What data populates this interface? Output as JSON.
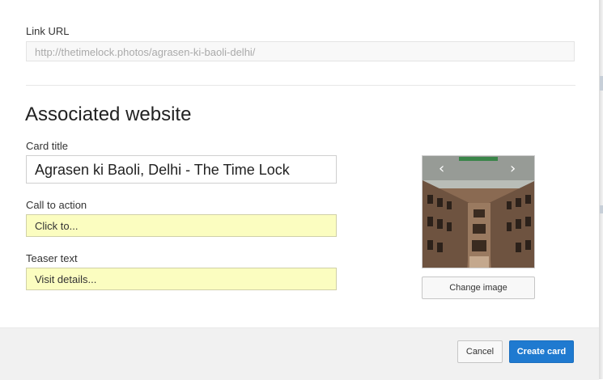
{
  "link_url": {
    "label": "Link URL",
    "value": "http://thetimelock.photos/agrasen-ki-baoli-delhi/"
  },
  "associated_website": {
    "heading": "Associated website",
    "card_title": {
      "label": "Card title",
      "value": "Agrasen ki Baoli, Delhi - The Time Lock"
    },
    "call_to_action": {
      "label": "Call to action",
      "value": "Click to..."
    },
    "teaser_text": {
      "label": "Teaser text",
      "value": "Visit details..."
    },
    "image": {
      "prev_icon": "chevron-left-icon",
      "next_icon": "chevron-right-icon",
      "prev_glyph": "‹",
      "next_glyph": "›",
      "change_label": "Change image"
    }
  },
  "footer": {
    "cancel_label": "Cancel",
    "create_label": "Create card"
  },
  "colors": {
    "primary": "#1f7ad0",
    "highlight_field": "#fbfdc0",
    "footer_bg": "#f1f1f1"
  }
}
